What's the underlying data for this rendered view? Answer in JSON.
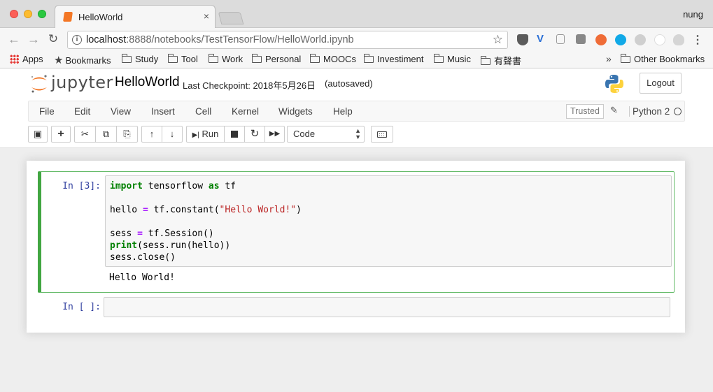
{
  "browser": {
    "tab_title": "HelloWorld",
    "tab_close": "×",
    "profile_name": "nung",
    "url_host": "localhost",
    "url_rest": ":8888/notebooks/TestTensorFlow/HelloWorld.ipynb",
    "info_icon": "i",
    "bookmarks": [
      "Apps",
      "Bookmarks",
      "Study",
      "Tool",
      "Work",
      "Personal",
      "MOOCs",
      "Investiment",
      "Music",
      "有聲書"
    ],
    "bookmarks_overflow": "»",
    "other_bookmarks": "Other Bookmarks"
  },
  "jupyter": {
    "logo_text": "jupyter",
    "notebook_name": "HelloWorld",
    "checkpoint": "Last Checkpoint: 2018年5月26日",
    "autosave_status": "(autosaved)",
    "logout_label": "Logout",
    "menu": [
      "File",
      "Edit",
      "View",
      "Insert",
      "Cell",
      "Kernel",
      "Widgets",
      "Help"
    ],
    "trusted_label": "Trusted",
    "kernel_name": "Python 2",
    "run_label": "Run",
    "cell_type": "Code",
    "cell_type_options_visible": [
      "Code"
    ]
  },
  "cells": [
    {
      "prompt": "In [3]:",
      "code_lines": [
        "import tensorflow as tf",
        "",
        "hello = tf.constant(\"Hello World!\")",
        "",
        "sess = tf.Session()",
        "print(sess.run(hello))",
        "sess.close()"
      ],
      "output": "Hello World!"
    },
    {
      "prompt": "In [ ]:",
      "code_lines": [],
      "output": ""
    }
  ],
  "colors": {
    "jupyter_orange": "#f37726",
    "selected_cell_border": "#42a642",
    "prompt_blue": "#303f9f",
    "keyword_green": "#008000",
    "string_red": "#ba2121",
    "operator_purple": "#aa22ff"
  }
}
